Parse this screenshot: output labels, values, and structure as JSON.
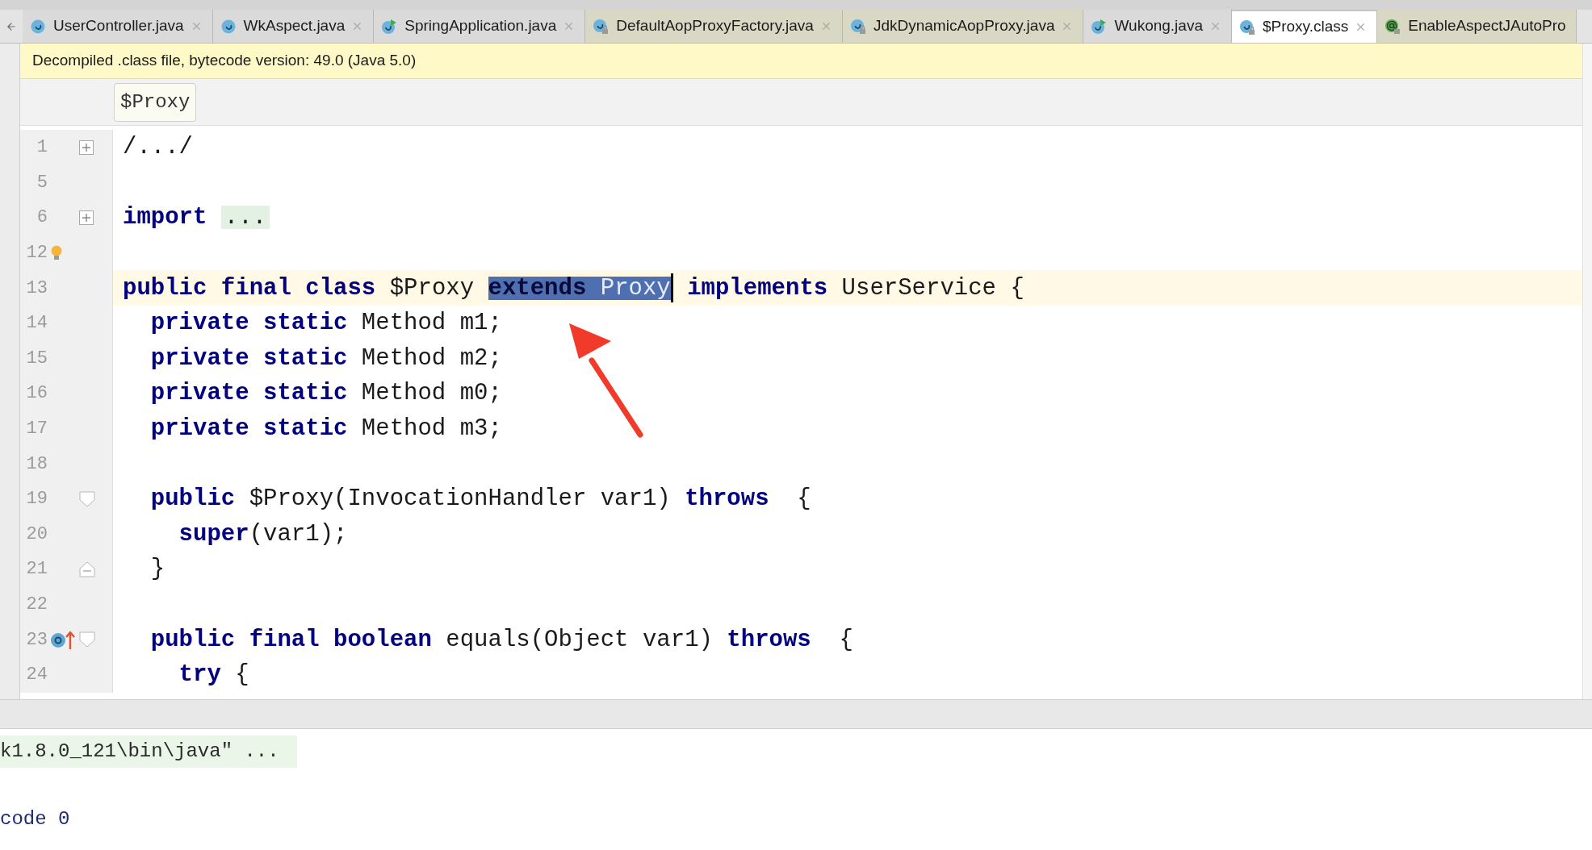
{
  "tabs": [
    {
      "label": "UserController.java",
      "selected": false,
      "kind": "class",
      "color": "#dadada"
    },
    {
      "label": "WkAspect.java",
      "selected": false,
      "kind": "class",
      "color": "#dadada"
    },
    {
      "label": "SpringApplication.java",
      "selected": false,
      "kind": "class-run",
      "color": "#dadada"
    },
    {
      "label": "DefaultAopProxyFactory.java",
      "selected": false,
      "kind": "class-locked",
      "color": "#d8d8c4"
    },
    {
      "label": "JdkDynamicAopProxy.java",
      "selected": false,
      "kind": "class-locked",
      "color": "#d8d8c4"
    },
    {
      "label": "Wukong.java",
      "selected": false,
      "kind": "class-run",
      "color": "#dadada"
    },
    {
      "label": "$Proxy.class",
      "selected": true,
      "kind": "class-locked",
      "color": "#ffffff"
    },
    {
      "label": "EnableAspectJAutoPro",
      "selected": false,
      "kind": "annotation",
      "color": "#d8d8c4"
    }
  ],
  "banner": "Decompiled .class file, bytecode version: 49.0 (Java 5.0)",
  "breadcrumb": "$Proxy",
  "lines": [
    {
      "number": "1",
      "current": false,
      "fold": {
        "kind": "collapsed"
      },
      "tokens": [
        {
          "kind": "plain",
          "text": "/.../"
        }
      ]
    },
    {
      "number": "5",
      "current": false
    },
    {
      "number": "6",
      "current": false,
      "fold": {
        "kind": "collapsed"
      },
      "tokens": [
        {
          "kind": "keyword",
          "text": "import "
        },
        {
          "kind": "folded",
          "text": "..."
        }
      ]
    },
    {
      "number": "12",
      "current": false,
      "gutter_icon": {
        "kind": "bulb"
      }
    },
    {
      "number": "13",
      "current": true,
      "tokens": [
        {
          "kind": "keyword",
          "text": "public final class"
        },
        {
          "kind": "plain",
          "text": " $Proxy "
        },
        {
          "kind": "selected",
          "text": "extends"
        },
        {
          "kind": "selected-plain",
          "text": " Proxy"
        },
        {
          "kind": "caret"
        },
        {
          "kind": "keyword",
          "text": " implements"
        },
        {
          "kind": "plain",
          "text": " UserService {"
        }
      ]
    },
    {
      "number": "14",
      "current": false,
      "tokens": [
        {
          "kind": "keyword",
          "text": "  private static"
        },
        {
          "kind": "plain",
          "text": " Method m1;"
        }
      ]
    },
    {
      "number": "15",
      "current": false,
      "tokens": [
        {
          "kind": "keyword",
          "text": "  private static"
        },
        {
          "kind": "plain",
          "text": " Method m2;"
        }
      ]
    },
    {
      "number": "16",
      "current": false,
      "tokens": [
        {
          "kind": "keyword",
          "text": "  private static"
        },
        {
          "kind": "plain",
          "text": " Method m0;"
        }
      ]
    },
    {
      "number": "17",
      "current": false,
      "tokens": [
        {
          "kind": "keyword",
          "text": "  private static"
        },
        {
          "kind": "plain",
          "text": " Method m3;"
        }
      ]
    },
    {
      "number": "18",
      "current": false
    },
    {
      "number": "19",
      "current": false,
      "fold": {
        "kind": "start"
      },
      "tokens": [
        {
          "kind": "keyword",
          "text": "  public"
        },
        {
          "kind": "plain",
          "text": " $Proxy(InvocationHandler var1) "
        },
        {
          "kind": "keyword",
          "text": "throws"
        },
        {
          "kind": "plain",
          "text": "  {"
        }
      ]
    },
    {
      "number": "20",
      "current": false,
      "tokens": [
        {
          "kind": "keyword",
          "text": "    super"
        },
        {
          "kind": "plain",
          "text": "(var1);"
        }
      ]
    },
    {
      "number": "21",
      "current": false,
      "fold": {
        "kind": "end"
      },
      "tokens": [
        {
          "kind": "plain",
          "text": "  }"
        }
      ]
    },
    {
      "number": "22",
      "current": false
    },
    {
      "number": "23",
      "current": false,
      "fold": {
        "kind": "start"
      },
      "gutter_icon": {
        "kind": "override"
      },
      "tokens": [
        {
          "kind": "keyword",
          "text": "  public final boolean"
        },
        {
          "kind": "plain",
          "text": " equals(Object var1) "
        },
        {
          "kind": "keyword",
          "text": "throws"
        },
        {
          "kind": "plain",
          "text": "  {"
        }
      ]
    },
    {
      "number": "24",
      "current": false,
      "tokens": [
        {
          "kind": "keyword",
          "text": "    try"
        },
        {
          "kind": "plain",
          "text": " {"
        }
      ]
    }
  ],
  "console": [
    {
      "text": "k1.8.0_121\\bin\\java\" ...",
      "kind": "command"
    },
    {
      "text": "code 0",
      "kind": "exit"
    }
  ]
}
